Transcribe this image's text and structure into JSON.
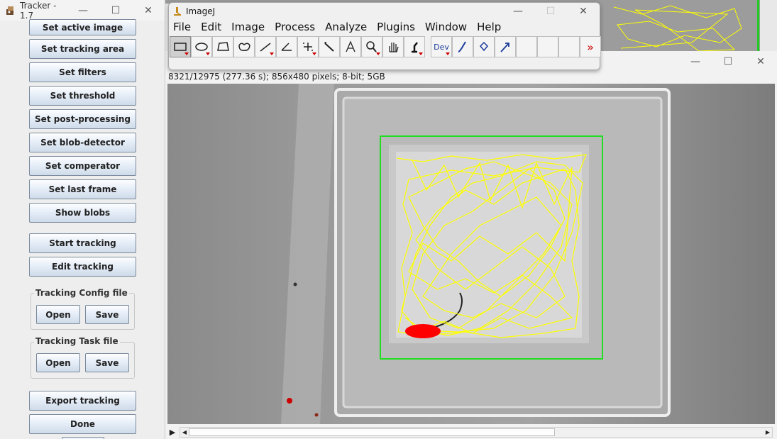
{
  "tracker": {
    "title": "Tracker - 1.7",
    "buttons": [
      "Set active image",
      "Set tracking area",
      "Set filters",
      "Set threshold",
      "Set post-processing",
      "Set blob-detector",
      "Set comperator",
      "Set last frame",
      "Show blobs",
      "Start tracking",
      "Edit tracking",
      "Export tracking",
      "Done"
    ],
    "config_group": {
      "label": "Tracking Config file",
      "open": "Open",
      "save": "Save"
    },
    "task_group": {
      "label": "Tracking Task file",
      "open": "Open",
      "save": "Save"
    }
  },
  "imagej": {
    "title": "ImageJ",
    "menus": [
      "File",
      "Edit",
      "Image",
      "Process",
      "Analyze",
      "Plugins",
      "Window",
      "Help"
    ],
    "tools": [
      "rectangle-tool-icon",
      "oval-tool-icon",
      "polygon-tool-icon",
      "freehand-tool-icon",
      "line-tool-icon",
      "angle-tool-icon",
      "point-tool-icon",
      "wand-tool-icon",
      "text-tool-icon",
      "magnifier-tool-icon",
      "scroll-tool-icon",
      "color-picker-tool-icon",
      "dev-tool-icon",
      "brush-tool-icon",
      "flood-fill-tool-icon",
      "arrow-tool-icon",
      "empty-slot",
      "empty-slot",
      "empty-slot",
      "more-tools-icon"
    ],
    "dev_label": "Dev"
  },
  "image_window": {
    "info": "8321/12975 (277.36 s); 856x480 pixels; 8-bit; 5GB",
    "colors": {
      "track": "#ffff00",
      "roi": "#22cc22",
      "blob": "#ff0000"
    }
  }
}
